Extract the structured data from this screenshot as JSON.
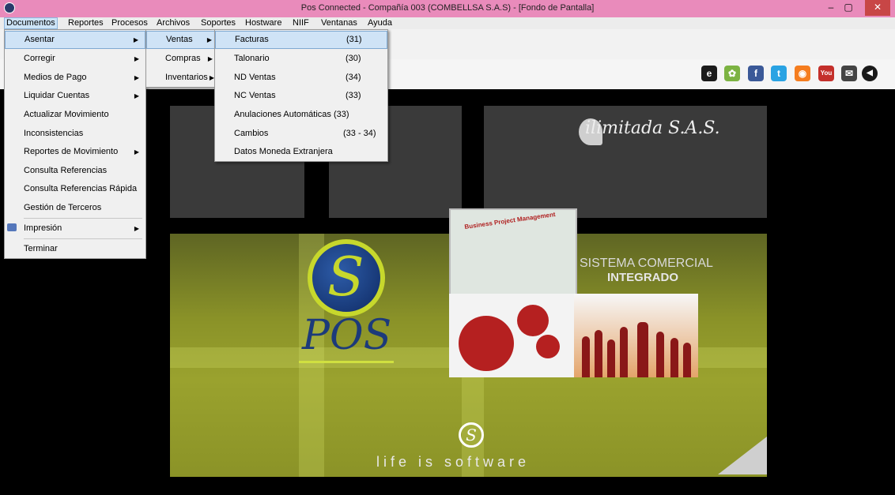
{
  "window": {
    "title": "Pos Connected - Compañía 003 (COMBELLSA S.A.S)  - [Fondo de Pantalla]",
    "minimize": "–",
    "maximize": "▢",
    "close": "✕"
  },
  "menubar": [
    {
      "label": "Documentos"
    },
    {
      "label": "Reportes"
    },
    {
      "label": "Procesos"
    },
    {
      "label": "Archivos"
    },
    {
      "label": "Soportes"
    },
    {
      "label": "Hostware"
    },
    {
      "label": "NIIF"
    },
    {
      "label": "Ventanas"
    },
    {
      "label": "Ayuda"
    }
  ],
  "documentos_menu": [
    {
      "label": "Asentar"
    },
    {
      "label": "Corregir"
    },
    {
      "label": "Medios de Pago"
    },
    {
      "label": "Liquidar Cuentas"
    },
    {
      "label": "Actualizar Movimiento"
    },
    {
      "label": "Inconsistencias"
    },
    {
      "label": "Reportes de Movimiento"
    },
    {
      "label": "Consulta Referencias"
    },
    {
      "label": "Consulta Referencias Rápida"
    },
    {
      "label": "Gestión de Terceros"
    },
    {
      "label": "Impresión"
    },
    {
      "label": "Terminar"
    }
  ],
  "asentar_menu": [
    {
      "label": "Ventas"
    },
    {
      "label": "Compras"
    },
    {
      "label": "Inventarios"
    }
  ],
  "ventas_menu": [
    {
      "label": "Facturas",
      "count": "(31)"
    },
    {
      "label": "Talonario",
      "count": "(30)"
    },
    {
      "label": "ND Ventas",
      "count": "(34)"
    },
    {
      "label": "NC Ventas",
      "count": "(33)"
    },
    {
      "label": "Anulaciones Automáticas (33)",
      "count": ""
    },
    {
      "label": "Cambios",
      "count": "(33 - 34)"
    },
    {
      "label": "Datos Moneda Extranjera",
      "count": ""
    }
  ],
  "arrow_glyph": "▶",
  "social_icons": [
    "e-icon",
    "android-icon",
    "facebook-icon",
    "twitter-icon",
    "rss-icon",
    "youtube-icon",
    "mail-icon",
    "back-icon"
  ],
  "social_glyphs": [
    "e",
    "✿",
    "f",
    "t",
    "◉",
    "You",
    "✉",
    "◀"
  ],
  "social_colors": [
    "#1b1b1b",
    "#7cb342",
    "#3b5998",
    "#2aa3e3",
    "#f57d1f",
    "#c4302b",
    "#444444",
    "#1a1a1a"
  ],
  "wallpaper": {
    "brand": "ilimitada S.A.S.",
    "logo_letter": "S",
    "pos": "POS",
    "bpm_title": "Business Project Management",
    "sistema_line1": "SISTEMA COMERCIAL",
    "sistema_line2": "INTEGRADO",
    "tagline": "life is software"
  },
  "colors": {
    "titlebar": "#e98bbb",
    "menu_highlight": "#cfe3f6",
    "wallpaper_green": "#9aa22e"
  }
}
